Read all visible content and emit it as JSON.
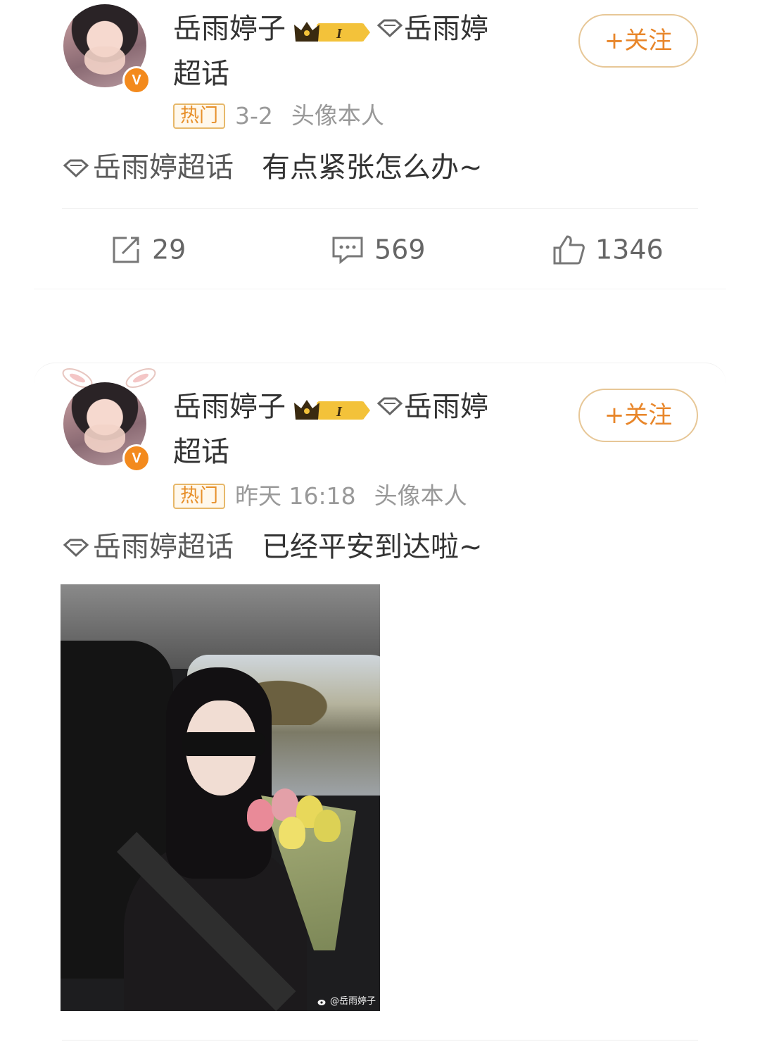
{
  "posts": [
    {
      "user": {
        "name": "岳雨婷子",
        "badge_level": "I",
        "topic_tail_1": "岳雨婷",
        "topic_tail_2": "超话"
      },
      "follow_label": "+关注",
      "hot_label": "热门",
      "time": "3-2",
      "source": "头像本人",
      "topic": "岳雨婷超话",
      "text": "有点紧张怎么办~",
      "stats": {
        "repost": "29",
        "comment": "569",
        "like": "1346"
      }
    },
    {
      "user": {
        "name": "岳雨婷子",
        "badge_level": "I",
        "topic_tail_1": "岳雨婷",
        "topic_tail_2": "超话"
      },
      "follow_label": "+关注",
      "hot_label": "热门",
      "time": "昨天 16:18",
      "source": "头像本人",
      "topic": "岳雨婷超话",
      "text": "已经平安到达啦~",
      "image_watermark": "@岳雨婷子"
    }
  ],
  "colors": {
    "accent": "#e8862a",
    "hot_border": "#e7b86a",
    "verified": "#f38a1d",
    "crown": "#e2b233"
  },
  "icons": [
    "repost-icon",
    "comment-icon",
    "like-icon",
    "diamond-icon",
    "crown-icon",
    "verified-icon",
    "bunny-ears-icon",
    "weibo-logo-icon"
  ]
}
